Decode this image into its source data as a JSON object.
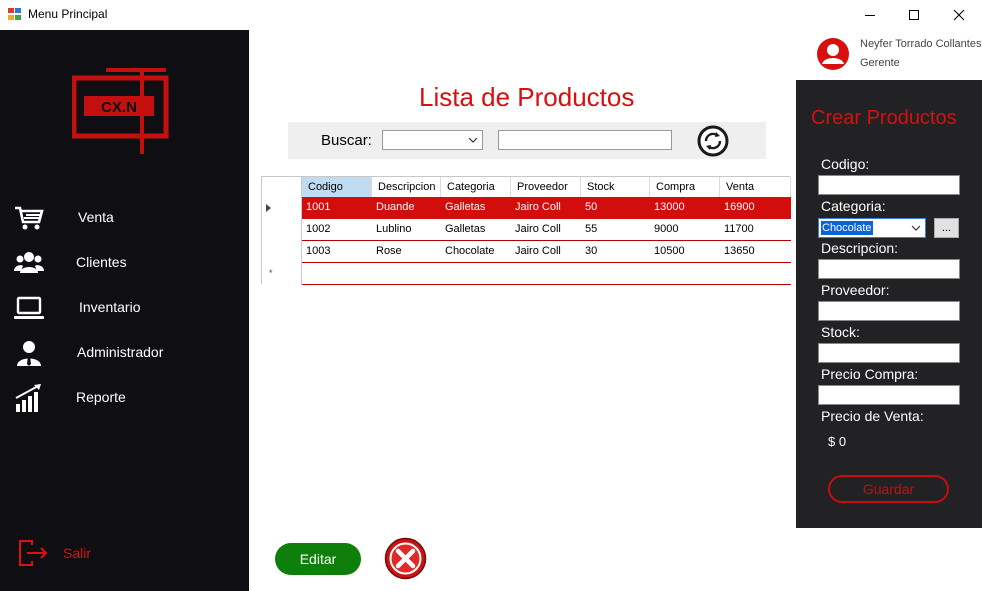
{
  "window": {
    "title": "Menu Principal"
  },
  "sidebar": {
    "logo_text": "CX.N",
    "items": [
      {
        "label": "Venta",
        "icon": "cart-icon"
      },
      {
        "label": "Clientes",
        "icon": "users-icon"
      },
      {
        "label": "Inventario",
        "icon": "laptop-icon"
      },
      {
        "label": "Administrador",
        "icon": "admin-icon"
      },
      {
        "label": "Reporte",
        "icon": "chart-bars-icon"
      }
    ],
    "logout_label": "Salir"
  },
  "user": {
    "name": "Neyfer Torrado Collantes",
    "role": "Gerente"
  },
  "main": {
    "title": "Lista de Productos",
    "search_label": "Buscar:",
    "search_select_value": "",
    "search_value": "",
    "table": {
      "columns": [
        "Codigo",
        "Descripcion",
        "Categoria",
        "Proveedor",
        "Stock",
        "Compra",
        "Venta"
      ],
      "rows": [
        [
          "1001",
          "Duande",
          "Galletas",
          "Jairo Coll",
          "50",
          "13000",
          "16900"
        ],
        [
          "1002",
          "Lublino",
          "Galletas",
          "Jairo Coll",
          "55",
          "9000",
          "11700"
        ],
        [
          "1003",
          "Rose",
          "Chocolate",
          "Jairo Coll",
          "30",
          "10500",
          "13650"
        ]
      ],
      "selected_row": 0,
      "new_row_marker": "*"
    },
    "edit_label": "Editar"
  },
  "panel": {
    "title": "Crear Productos",
    "codigo_label": "Codigo:",
    "codigo_value": "",
    "categoria_label": "Categoria:",
    "categoria_value": "Chocolate",
    "more_label": "...",
    "descripcion_label": "Descripcion:",
    "descripcion_value": "",
    "proveedor_label": "Proveedor:",
    "proveedor_value": "",
    "stock_label": "Stock:",
    "stock_value": "",
    "compra_label": "Precio Compra:",
    "compra_value": "",
    "venta_label": "Precio de Venta:",
    "venta_value": "$  0",
    "save_label": "Guardar"
  },
  "colors": {
    "accent_red": "#d80f0f",
    "sidebar_bg": "#0f0e13",
    "panel_bg": "#222124",
    "edit_green": "#0d7f0a"
  }
}
